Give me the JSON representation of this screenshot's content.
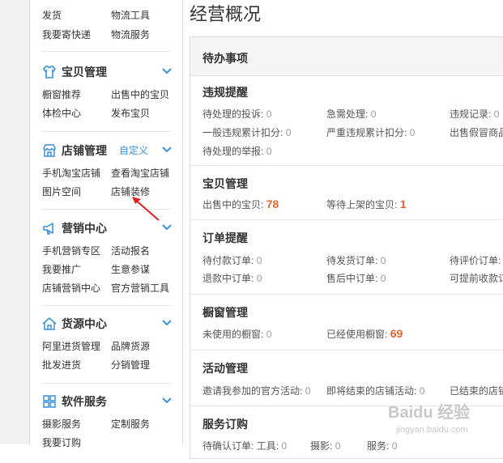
{
  "sidebar": {
    "top_links": [
      "发货",
      "物流工具",
      "我要寄快递",
      "物流服务"
    ],
    "baobei": {
      "title": "宝贝管理",
      "links": [
        "橱窗推荐",
        "出售中的宝贝",
        "体检中心",
        "发布宝贝"
      ]
    },
    "dianpu": {
      "title": "店铺管理",
      "custom": "自定义",
      "links": [
        "手机淘宝店铺",
        "查看淘宝店铺",
        "图片空间",
        "店铺装修"
      ]
    },
    "yingxiao": {
      "title": "营销中心",
      "links": [
        "手机营销专区",
        "活动报名",
        "我要推广",
        "生意参谋",
        "店铺营销中心",
        "官方营销工具"
      ]
    },
    "huoyuan": {
      "title": "货源中心",
      "links": [
        "阿里进货管理",
        "品牌货源",
        "批发进货",
        "分销管理"
      ]
    },
    "ruanjian": {
      "title": "软件服务",
      "links": [
        "摄影服务",
        "定制服务",
        "我要订购"
      ]
    }
  },
  "main": {
    "title": "经营概况",
    "panel_title": "待办事项",
    "weigui": {
      "title": "违规提醒",
      "items": [
        {
          "label": "待处理的投诉:",
          "value": "0"
        },
        {
          "label": "急需处理:",
          "value": "0"
        },
        {
          "label": "违规记录:",
          "value": "0"
        },
        {
          "label": "一般违规累计扣分:",
          "value": "0"
        },
        {
          "label": "严重违规累计扣分:",
          "value": "0"
        },
        {
          "label": "出售假冒商品",
          "value": ""
        },
        {
          "label": "待处理的举报:",
          "value": "0"
        }
      ]
    },
    "baobei": {
      "title": "宝贝管理",
      "items": [
        {
          "label": "出售中的宝贝:",
          "value": "78"
        },
        {
          "label": "等待上架的宝贝:",
          "value": "1"
        }
      ]
    },
    "dingdan": {
      "title": "订单提醒",
      "items": [
        {
          "label": "待付款订单:",
          "value": "0"
        },
        {
          "label": "待发货订单:",
          "value": "0"
        },
        {
          "label": "待评价订单:",
          "value": ""
        },
        {
          "label": "退款中订单:",
          "value": "0"
        },
        {
          "label": "售后中订单:",
          "value": "0"
        },
        {
          "label": "可提前收款订",
          "value": ""
        }
      ]
    },
    "chuchuang": {
      "title": "橱窗管理",
      "items": [
        {
          "label": "未使用的橱窗:",
          "value": "0"
        },
        {
          "label": "已经使用橱窗:",
          "value": "69"
        }
      ]
    },
    "huodong": {
      "title": "活动管理",
      "items": [
        {
          "label": "邀请我参加的官方活动:",
          "value": "0"
        },
        {
          "label": "即将结束的店铺活动:",
          "value": "0"
        },
        {
          "label": "已结束的店铺",
          "value": ""
        }
      ]
    },
    "fuwu": {
      "title": "服务订购",
      "items": [
        {
          "label": "待确认订单:",
          "value": "工具:",
          "extra": "0"
        },
        {
          "label": "摄影:",
          "value": "0"
        },
        {
          "label": "服务:",
          "value": "0"
        }
      ]
    }
  },
  "watermark": {
    "text": "Baidu 经验",
    "sub": "jingyan.baidu.com"
  },
  "colors": {
    "accent": "#3a8fd8",
    "number": "#e8632a",
    "divider": "#e6e6e6"
  }
}
